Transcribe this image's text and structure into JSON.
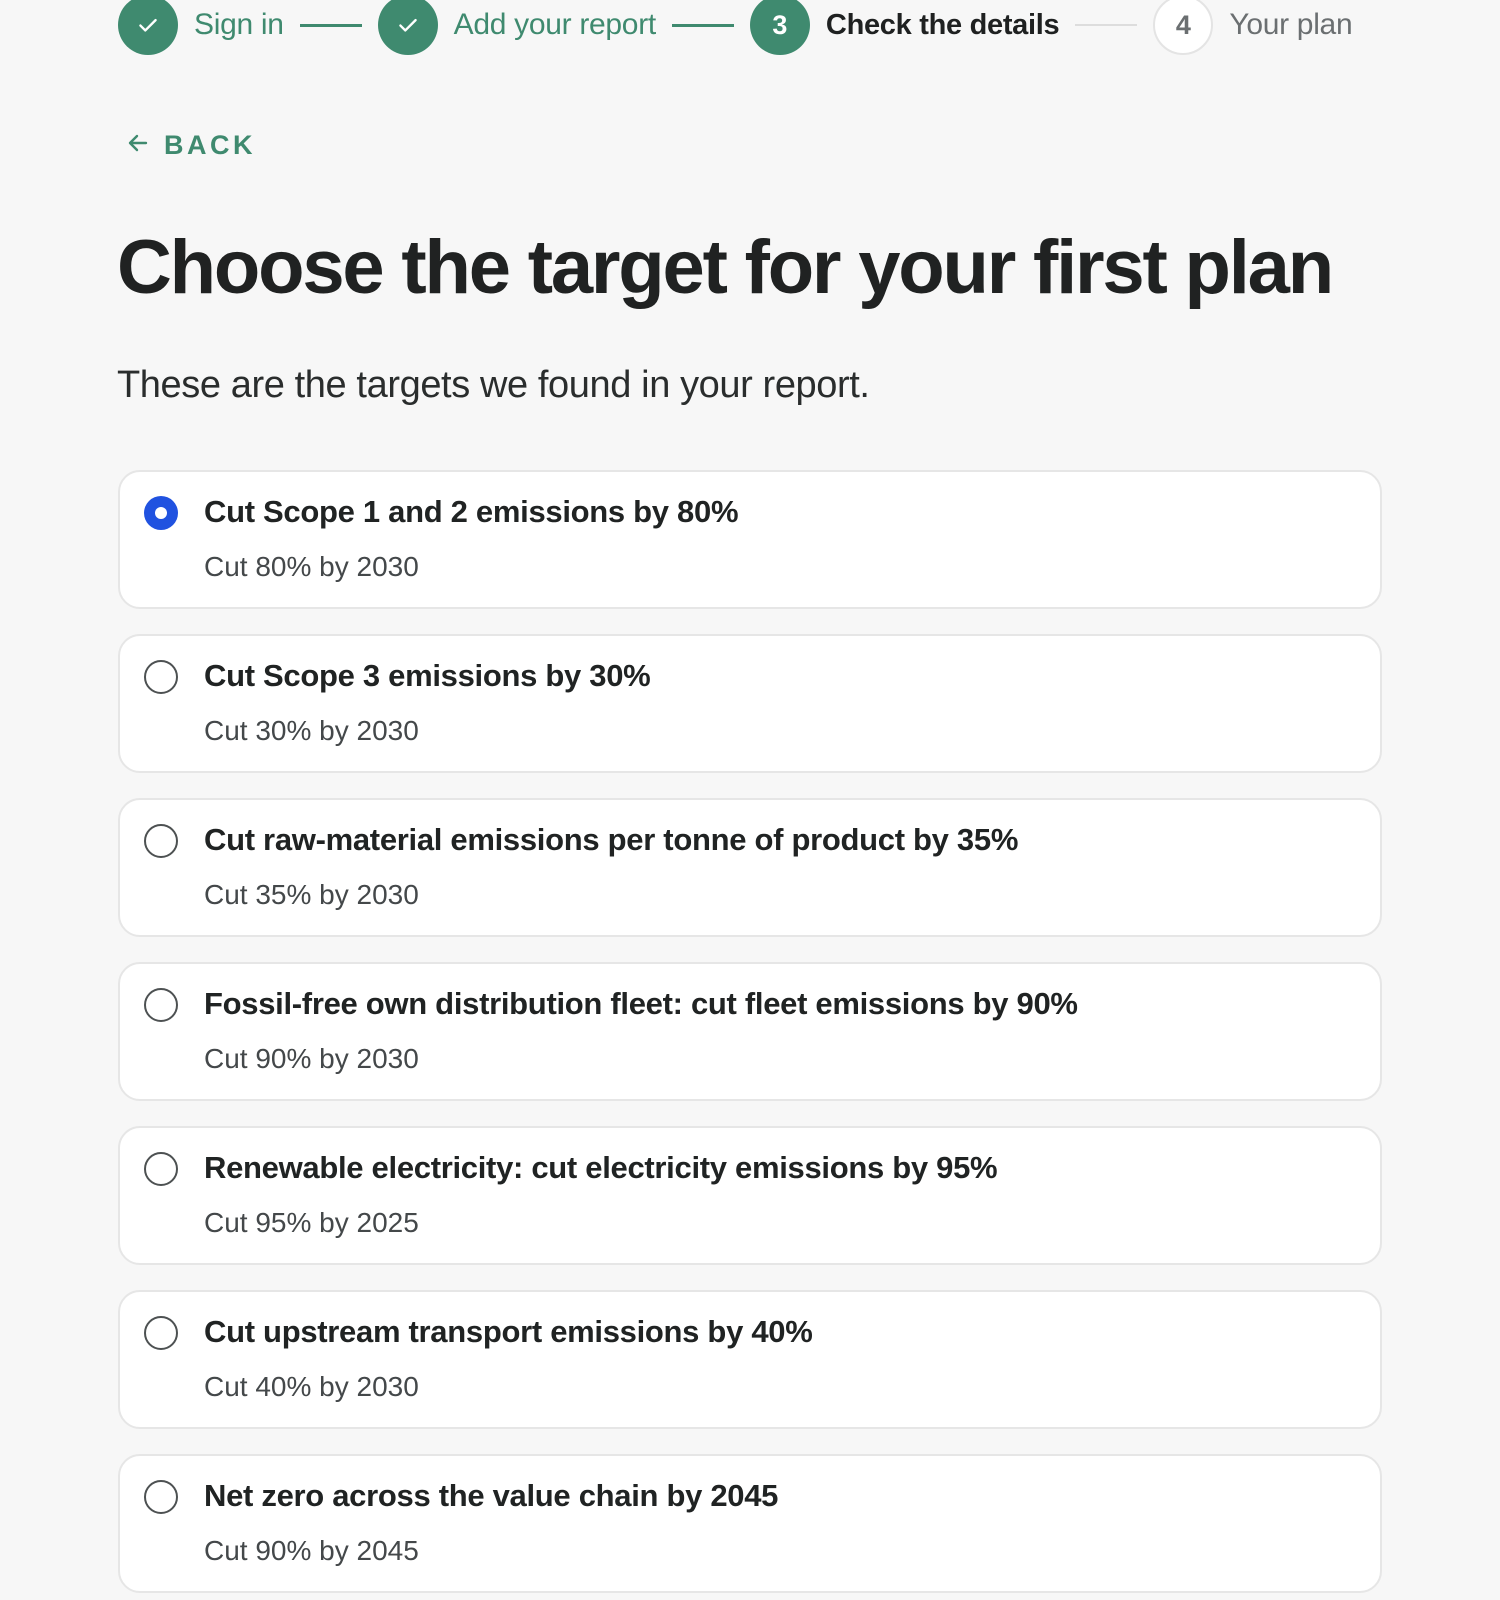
{
  "stepper": {
    "steps": [
      {
        "label": "Sign in",
        "state": "done",
        "icon": "check-icon"
      },
      {
        "label": "Add your report",
        "state": "done",
        "icon": "check-icon"
      },
      {
        "label": "Check the details",
        "state": "current",
        "number": "3"
      },
      {
        "label": "Your plan",
        "state": "pending",
        "number": "4"
      }
    ]
  },
  "back": {
    "label": "BACK",
    "icon": "arrow-left-icon"
  },
  "page": {
    "title": "Choose the target for your first plan",
    "subtitle": "These are the targets we found in your report."
  },
  "targets": [
    {
      "title": "Cut Scope 1 and 2 emissions by 80%",
      "detail": "Cut 80% by 2030",
      "selected": true
    },
    {
      "title": "Cut Scope 3 emissions by 30%",
      "detail": "Cut 30% by 2030",
      "selected": false
    },
    {
      "title": "Cut raw-material emissions per tonne of product by 35%",
      "detail": "Cut 35% by 2030",
      "selected": false
    },
    {
      "title": "Fossil-free own distribution fleet: cut fleet emissions by 90%",
      "detail": "Cut 90% by 2030",
      "selected": false
    },
    {
      "title": "Renewable electricity: cut electricity emissions by 95%",
      "detail": "Cut 95% by 2025",
      "selected": false
    },
    {
      "title": "Cut upstream transport emissions by 40%",
      "detail": "Cut 40% by 2030",
      "selected": false
    },
    {
      "title": "Net zero across the value chain by 2045",
      "detail": "Cut 90% by 2045",
      "selected": false
    }
  ],
  "colors": {
    "accent_green": "#3f8a6f",
    "radio_selected": "#2052e0",
    "background": "#f7f7f7"
  }
}
